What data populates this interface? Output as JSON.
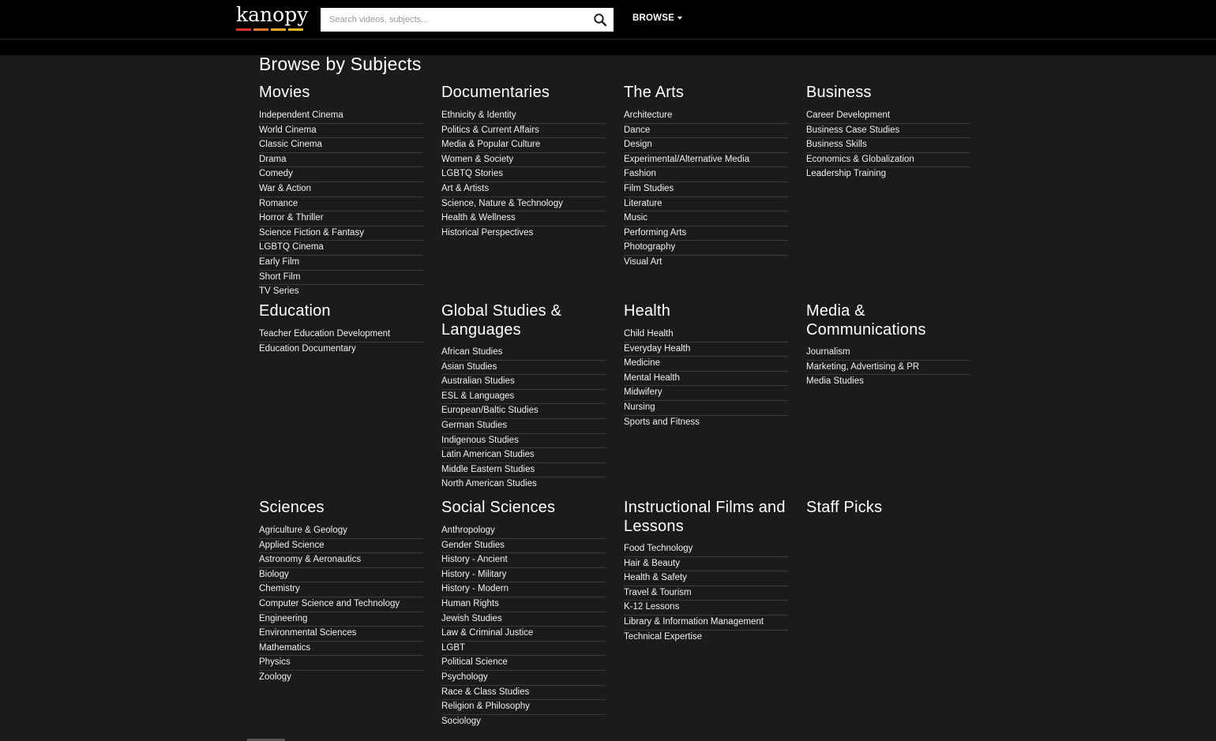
{
  "header": {
    "logo_text": "kanopy",
    "logo_colors": [
      "#d6322d",
      "#e3792b",
      "#f2a62b",
      "#f2b72b"
    ],
    "search": {
      "placeholder": "Search videos, subjects...",
      "icon": "search-icon"
    },
    "browse_label": "BROWSE"
  },
  "page": {
    "title": "Browse by Subjects"
  },
  "sections": [
    {
      "title": "Movies",
      "items": [
        "Independent Cinema",
        "World Cinema",
        "Classic Cinema",
        "Drama",
        "Comedy",
        "War & Action",
        "Romance",
        "Horror & Thriller",
        "Science Fiction & Fantasy",
        "LGBTQ Cinema",
        "Early Film",
        "Short Film",
        "TV Series"
      ]
    },
    {
      "title": "Documentaries",
      "items": [
        "Ethnicity & Identity",
        "Politics & Current Affairs",
        "Media & Popular Culture",
        "Women & Society",
        "LGBTQ Stories",
        "Art & Artists",
        "Science, Nature & Technology",
        "Health & Wellness",
        "Historical Perspectives"
      ]
    },
    {
      "title": "The Arts",
      "items": [
        "Architecture",
        "Dance",
        "Design",
        "Experimental/Alternative Media",
        "Fashion",
        "Film Studies",
        "Literature",
        "Music",
        "Performing Arts",
        "Photography",
        "Visual Art"
      ]
    },
    {
      "title": "Business",
      "items": [
        "Career Development",
        "Business Case Studies",
        "Business Skills",
        "Economics & Globalization",
        "Leadership Training"
      ]
    },
    {
      "title": "Education",
      "items": [
        "Teacher Education Development",
        "Education Documentary"
      ]
    },
    {
      "title": "Global Studies & Languages",
      "items": [
        "African Studies",
        "Asian Studies",
        "Australian Studies",
        "ESL & Languages",
        "European/Baltic Studies",
        "German Studies",
        "Indigenous Studies",
        "Latin American Studies",
        "Middle Eastern Studies",
        "North American Studies"
      ]
    },
    {
      "title": "Health",
      "items": [
        "Child Health",
        "Everyday Health",
        "Medicine",
        "Mental Health",
        "Midwifery",
        "Nursing",
        "Sports and Fitness"
      ]
    },
    {
      "title": "Media & Communications",
      "items": [
        "Journalism",
        "Marketing, Advertising & PR",
        "Media Studies"
      ]
    },
    {
      "title": "Sciences",
      "items": [
        "Agriculture & Geology",
        "Applied Science",
        "Astronomy & Aeronautics",
        "Biology",
        "Chemistry",
        "Computer Science and Technology",
        "Engineering",
        "Environmental Sciences",
        "Mathematics",
        "Physics",
        "Zoology"
      ]
    },
    {
      "title": "Social Sciences",
      "items": [
        "Anthropology",
        "Gender Studies",
        "History - Ancient",
        "History - Military",
        "History - Modern",
        "Human Rights",
        "Jewish Studies",
        "Law & Criminal Justice",
        "LGBT",
        "Political Science",
        "Psychology",
        "Race & Class Studies",
        "Religion & Philosophy",
        "Sociology"
      ]
    },
    {
      "title": "Instructional Films and Lessons",
      "items": [
        "Food Technology",
        "Hair & Beauty",
        "Health & Safety",
        "Travel & Tourism",
        "K-12 Lessons",
        "Library & Information Management",
        "Technical Expertise"
      ]
    },
    {
      "title": "Staff Picks",
      "items": []
    }
  ]
}
